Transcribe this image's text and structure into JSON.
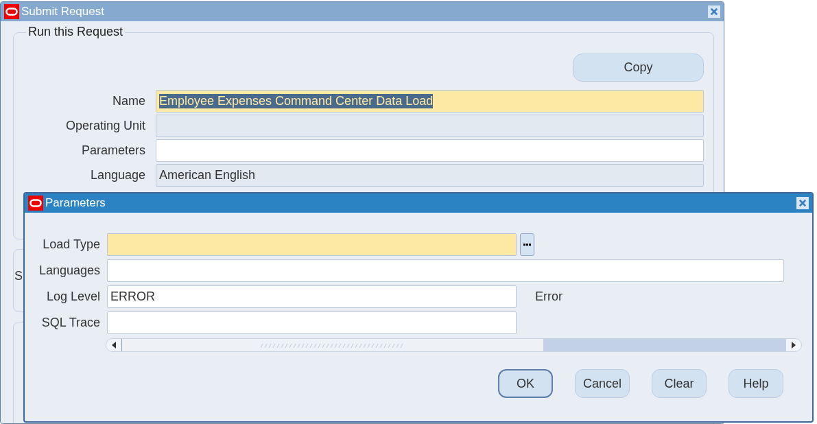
{
  "window": {
    "title": "Submit Request",
    "active": false
  },
  "run_group": {
    "title": "Run this Request",
    "copy_button": "Copy",
    "fields": [
      {
        "label": "Name",
        "kind": "required",
        "value": "Employee Expenses Command Center Data Load",
        "text_selected": true
      },
      {
        "label": "Operating Unit",
        "kind": "readonly"
      },
      {
        "label": "Parameters",
        "kind": "text"
      },
      {
        "label": "Language",
        "kind": "readonly",
        "value": "American English"
      }
    ]
  },
  "group_2": {
    "label": "S"
  },
  "dialog": {
    "title": "Parameters",
    "active": true,
    "fields": [
      {
        "label": "Load Type",
        "kind": "required",
        "wide": false,
        "lov": true
      },
      {
        "label": "Languages",
        "kind": "text",
        "wide": true
      },
      {
        "label": "Log Level",
        "kind": "text",
        "wide": false,
        "value": "ERROR",
        "description": "Error"
      },
      {
        "label": "SQL Trace",
        "kind": "text",
        "wide": false
      }
    ],
    "buttons": [
      {
        "label": "OK",
        "default": true
      },
      {
        "label": "Cancel",
        "default": false
      },
      {
        "label": "Clear",
        "default": false
      },
      {
        "label": "Help",
        "default": false
      }
    ]
  }
}
